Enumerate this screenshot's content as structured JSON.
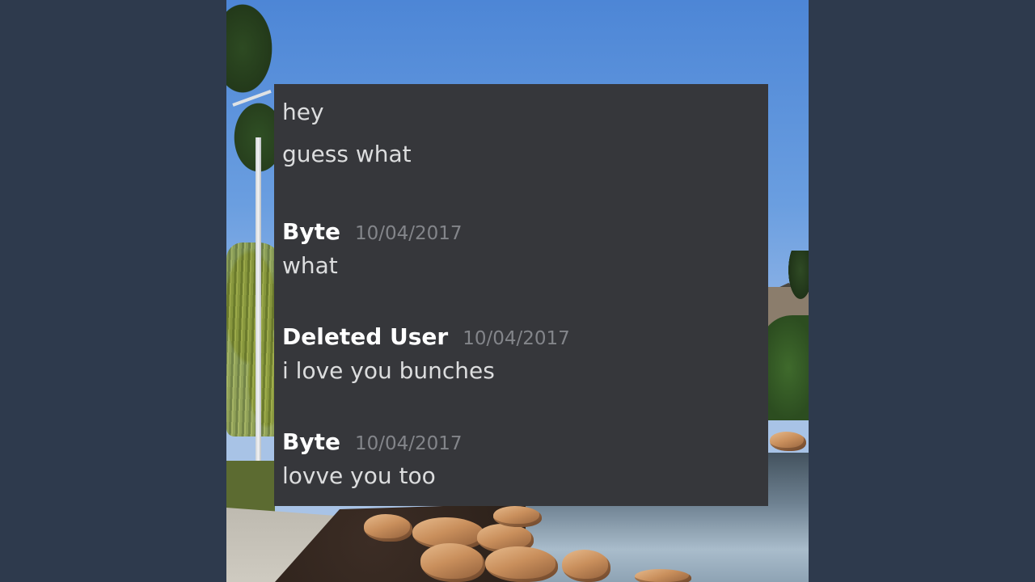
{
  "chat": {
    "intro": {
      "lines": [
        "hey",
        "guess what"
      ]
    },
    "messages": [
      {
        "author": "Byte",
        "timestamp": "10/04/2017",
        "text": "what"
      },
      {
        "author": "Deleted User",
        "timestamp": "10/04/2017",
        "text": "i love you bunches"
      },
      {
        "author": "Byte",
        "timestamp": "10/04/2017",
        "text": "lovve you too"
      }
    ]
  },
  "colors": {
    "page_background": "#2e3a4d",
    "chat_background": "#36373b",
    "author": "#ffffff",
    "message_text": "#dcddde",
    "timestamp": "#83858a"
  }
}
